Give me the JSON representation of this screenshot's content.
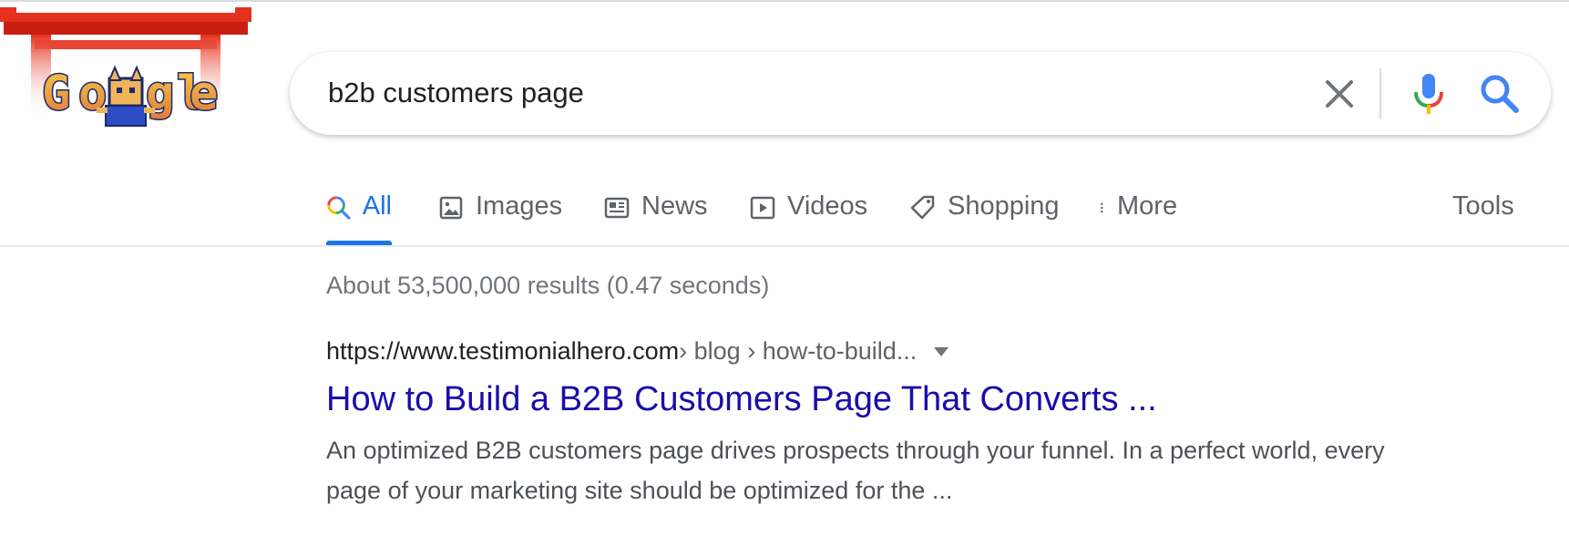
{
  "search": {
    "query": "b2b customers page"
  },
  "tabs": [
    {
      "label": "All",
      "icon": "search-multicolor-icon",
      "active": true
    },
    {
      "label": "Images",
      "icon": "image-icon"
    },
    {
      "label": "News",
      "icon": "newspaper-icon"
    },
    {
      "label": "Videos",
      "icon": "play-icon"
    },
    {
      "label": "Shopping",
      "icon": "tag-icon"
    },
    {
      "label": "More",
      "icon": "more-vert-icon"
    }
  ],
  "tools_label": "Tools",
  "result_stats": "About 53,500,000 results (0.47 seconds)",
  "results": [
    {
      "site": "https://www.testimonialhero.com",
      "breadcrumb": " › blog › how-to-build...",
      "title": "How to Build a B2B Customers Page That Converts ...",
      "snippet": "An optimized B2B customers page drives prospects through your funnel. In a perfect world, every page of your marketing site should be optimized for the ..."
    }
  ],
  "colors": {
    "accent": "#1a73e8",
    "link": "#1a0dab",
    "snippet": "#4d5156",
    "muted": "#70757a"
  }
}
